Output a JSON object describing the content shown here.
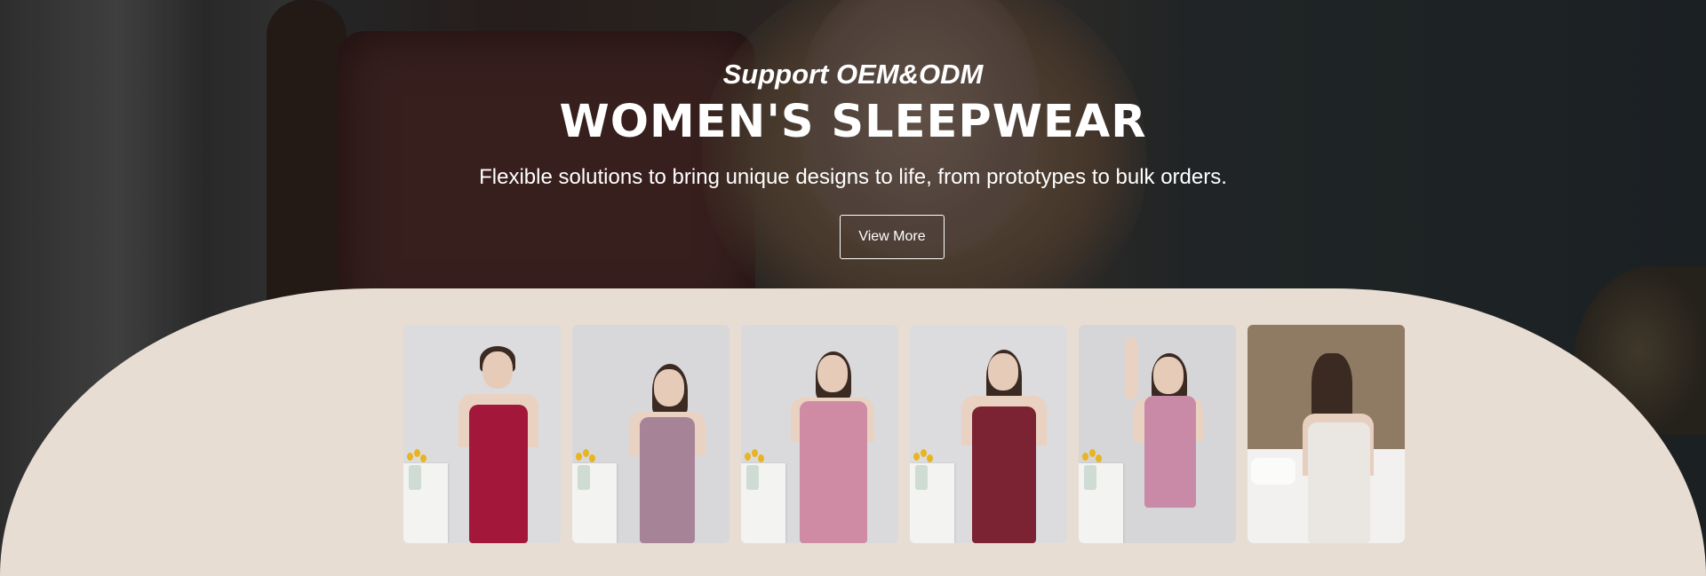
{
  "hero": {
    "subtitle": "Support OEM&ODM",
    "title": "WOMEN'S SLEEPWEAR",
    "tagline": "Flexible solutions to bring unique designs to life, from prototypes to bulk orders.",
    "cta_label": "View More"
  },
  "colors": {
    "panel_bg": "#e8ddd2",
    "text": "#ffffff"
  },
  "gallery": [
    {
      "dress_color": "#a3183a",
      "wall_color": "#dcdcde"
    },
    {
      "dress_color": "#a68397",
      "wall_color": "#d8d8da"
    },
    {
      "dress_color": "#cf8aa4",
      "wall_color": "#dadadc"
    },
    {
      "dress_color": "#7b2233",
      "wall_color": "#dcdcde"
    },
    {
      "dress_color": "#c98aa8",
      "wall_color": "#d6d6d8"
    },
    {
      "dress_color": "#eae6e2",
      "wall_color": "#8f7a63"
    }
  ]
}
